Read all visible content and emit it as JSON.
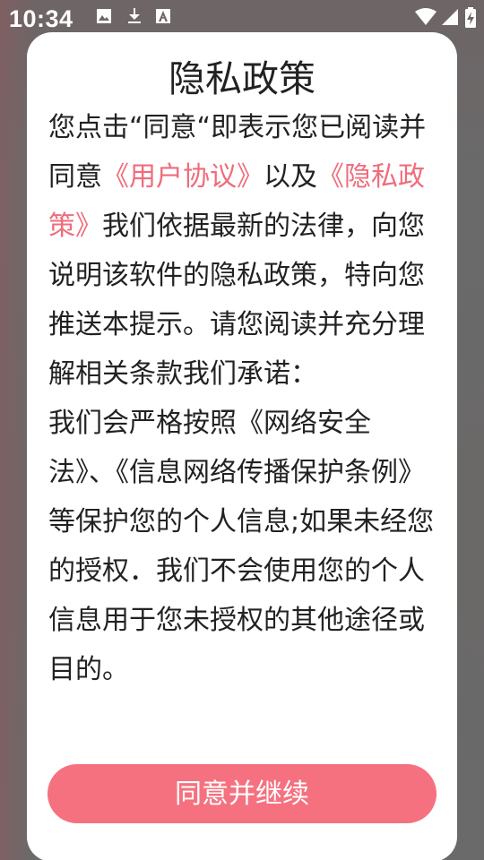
{
  "status_bar": {
    "time": "10:34",
    "icons": [
      "image-icon",
      "download-icon",
      "font-a-icon",
      "wifi-icon",
      "signal-icon",
      "battery-charging-icon"
    ]
  },
  "dialog": {
    "title": "隐私政策",
    "body_segments": [
      {
        "text": "您点击“同意“即表示您已阅读并同意",
        "link": false
      },
      {
        "text": "《用户协议》",
        "link": true
      },
      {
        "text": "以及",
        "link": false
      },
      {
        "text": "《隐私政策》",
        "link": true
      },
      {
        "text": "我们依据最新的法律，向您说明该软件的隐私政策，特向您推送本提示。请您阅读并充分理解相关条款我们承诺：",
        "link": false
      }
    ],
    "body_paragraph_2": "我们会严格按照《网络安全法》、《信息网络传播保护条例》等保护您的个人信息;如果未经您的授权．我们不会使用您的个人信息用于您未授权的其他途径或目的。",
    "agree_button_label": "同意并继续"
  },
  "colors": {
    "link": "#f06c7c",
    "button": "#f5717f",
    "text": "#222222",
    "overlay": "#6a6a6a"
  }
}
